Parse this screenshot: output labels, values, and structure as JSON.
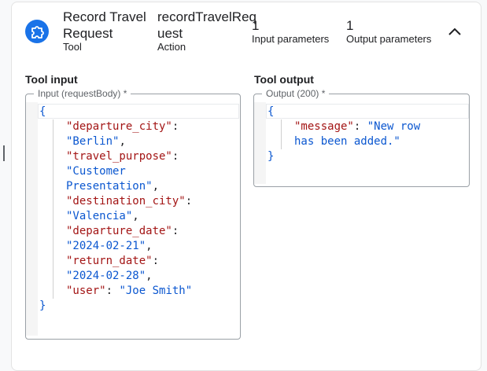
{
  "header": {
    "tool_name_line1": "Record Travel",
    "tool_name_line2": "Request",
    "tool_label": "Tool",
    "action_name_line1": "recordTravelReq",
    "action_name_line2": "uest",
    "action_label": "Action",
    "input_count": "1",
    "input_label": "Input parameters",
    "output_count": "1",
    "output_label": "Output parameters",
    "icons": {
      "tool": "puzzle-icon",
      "collapse": "chevron-up-icon"
    }
  },
  "tool_input": {
    "title": "Tool input",
    "legend": "Input (requestBody) *",
    "open_brace": "{",
    "close_brace": "}",
    "lines": [
      {
        "key": "\"departure_city\"",
        "sep": ":",
        "val": "",
        "end": ""
      },
      {
        "key": "",
        "sep": "",
        "val": "\"Berlin\"",
        "end": ","
      },
      {
        "key": "\"travel_purpose\"",
        "sep": ":",
        "val": "",
        "end": ""
      },
      {
        "key": "",
        "sep": "",
        "val": "\"Customer",
        "end": ""
      },
      {
        "key": "",
        "sep": "",
        "val": "Presentation\"",
        "end": ","
      },
      {
        "key": "\"destination_city\"",
        "sep": ":",
        "val": "",
        "end": ""
      },
      {
        "key": "",
        "sep": "",
        "val": "\"Valencia\"",
        "end": ","
      },
      {
        "key": "\"departure_date\"",
        "sep": ":",
        "val": "",
        "end": ""
      },
      {
        "key": "",
        "sep": "",
        "val": "\"2024-02-21\"",
        "end": ","
      },
      {
        "key": "\"return_date\"",
        "sep": ":",
        "val": "",
        "end": ""
      },
      {
        "key": "",
        "sep": "",
        "val": "\"2024-02-28\"",
        "end": ","
      },
      {
        "key": "\"user\"",
        "sep": ": ",
        "val": "\"Joe Smith\"",
        "end": ""
      }
    ]
  },
  "tool_output": {
    "title": "Tool output",
    "legend": "Output (200) *",
    "open_brace": "{",
    "close_brace": "}",
    "lines": [
      {
        "key": "\"message\"",
        "sep": ": ",
        "val": "\"New row",
        "end": ""
      },
      {
        "key": "",
        "sep": "",
        "val": "has been added.\"",
        "end": ""
      }
    ]
  },
  "colors": {
    "key": "#a31515",
    "value": "#0b57d0",
    "icon": "#1a73e8"
  }
}
